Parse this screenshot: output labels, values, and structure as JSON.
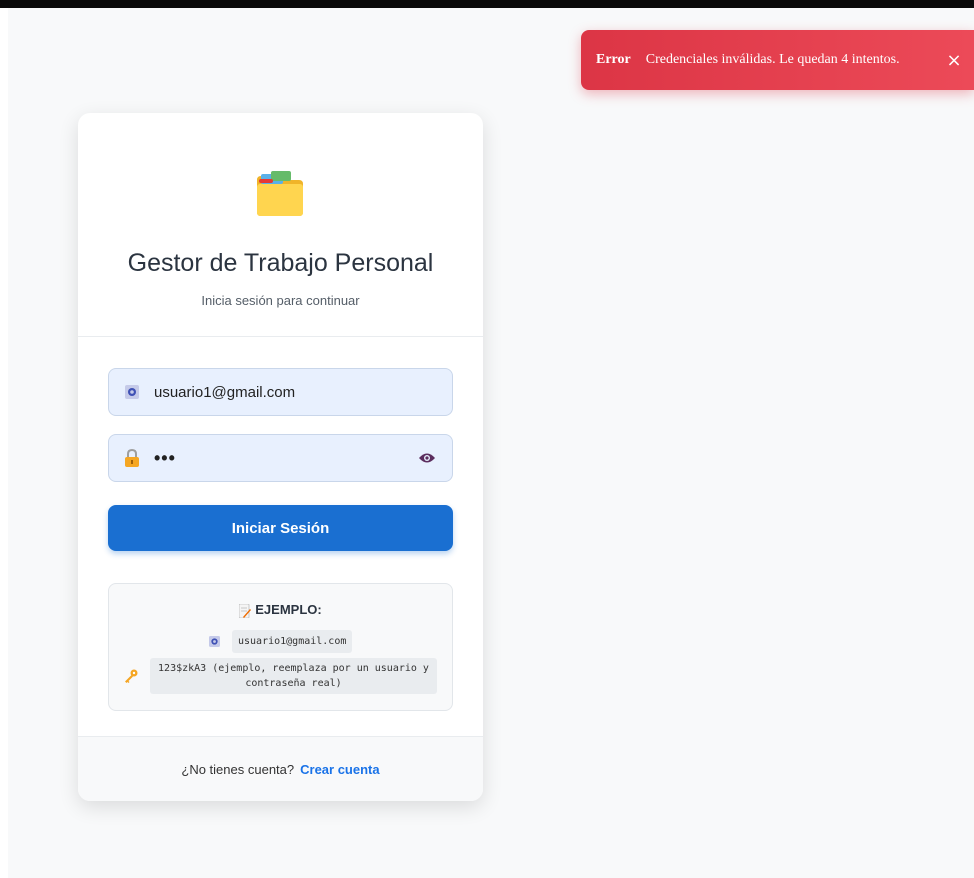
{
  "toast": {
    "title": "Error",
    "message": "Credenciales inválidas. Le quedan 4 intentos.",
    "close_icon": "×",
    "color": "#dc3545"
  },
  "header": {
    "icon": "folder-icon",
    "title": "Gestor de Trabajo Personal",
    "subtitle": "Inicia sesión para continuar"
  },
  "form": {
    "email_icon": "email-icon",
    "email_value": "usuario1@gmail.com",
    "password_icon": "lock-icon",
    "password_value": "•••",
    "toggle_icon": "eye-icon",
    "submit_label": "Iniciar Sesión",
    "accent_color": "#1a6fd1"
  },
  "example": {
    "title": "EJEMPLO:",
    "email": "usuario1@gmail.com",
    "password_note": "123$zkA3 (ejemplo, reemplaza por un usuario y contraseña real)"
  },
  "footer": {
    "prompt": "¿No tienes cuenta?",
    "link": "Crear cuenta"
  }
}
